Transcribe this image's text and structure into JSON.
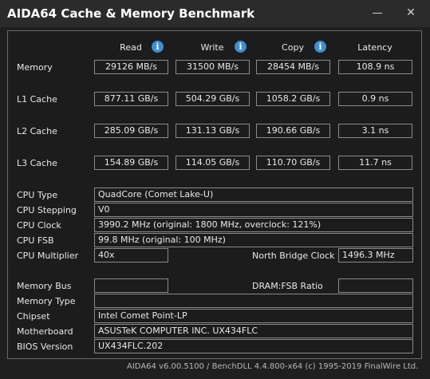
{
  "window": {
    "title": "AIDA64 Cache & Memory Benchmark",
    "minimize_glyph": "—",
    "close_glyph": "✕"
  },
  "columns": {
    "read": "Read",
    "write": "Write",
    "copy": "Copy",
    "latency": "Latency",
    "info_glyph": "i"
  },
  "rows": [
    {
      "label": "Memory",
      "read": "29126 MB/s",
      "write": "31500 MB/s",
      "copy": "28454 MB/s",
      "latency": "108.9 ns"
    },
    {
      "label": "L1 Cache",
      "read": "877.11 GB/s",
      "write": "504.29 GB/s",
      "copy": "1058.2 GB/s",
      "latency": "0.9 ns"
    },
    {
      "label": "L2 Cache",
      "read": "285.09 GB/s",
      "write": "131.13 GB/s",
      "copy": "190.66 GB/s",
      "latency": "3.1 ns"
    },
    {
      "label": "L3 Cache",
      "read": "154.89 GB/s",
      "write": "114.05 GB/s",
      "copy": "110.70 GB/s",
      "latency": "11.7 ns"
    }
  ],
  "cpu": {
    "type_label": "CPU Type",
    "type_value": "QuadCore   (Comet Lake-U)",
    "stepping_label": "CPU Stepping",
    "stepping_value": "V0",
    "clock_label": "CPU Clock",
    "clock_value": "3990.2 MHz  (original: 1800 MHz, overclock: 121%)",
    "fsb_label": "CPU FSB",
    "fsb_value": "99.8 MHz  (original: 100 MHz)",
    "multiplier_label": "CPU Multiplier",
    "multiplier_value": "40x",
    "nb_clock_label": "North Bridge Clock",
    "nb_clock_value": "1496.3 MHz"
  },
  "memory": {
    "bus_label": "Memory Bus",
    "bus_value": "",
    "ratio_label": "DRAM:FSB Ratio",
    "ratio_value": "",
    "type_label": "Memory Type",
    "type_value": ""
  },
  "board": {
    "chipset_label": "Chipset",
    "chipset_value": "Intel Comet Point-LP",
    "motherboard_label": "Motherboard",
    "motherboard_value": "ASUSTeK COMPUTER INC. UX434FLC",
    "bios_label": "BIOS Version",
    "bios_value": "UX434FLC.202"
  },
  "footer": "AIDA64 v6.00.5100 / BenchDLL 4.4.800-x64  (c) 1995-2019 FinalWire Ltd."
}
